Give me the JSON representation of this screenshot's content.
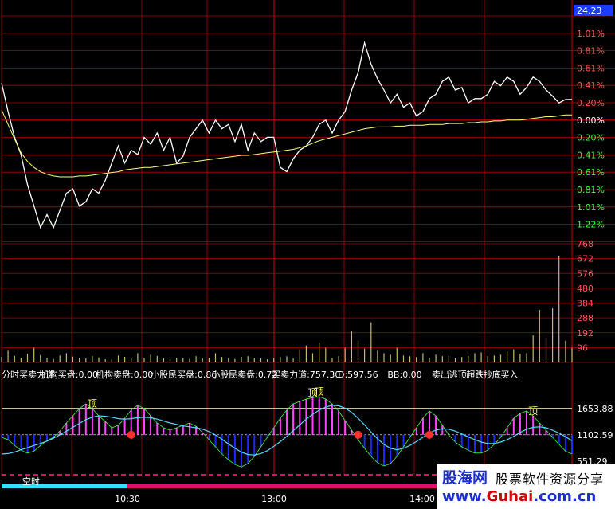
{
  "colors": {
    "price_line": "#ffffff",
    "avg_line": "#ffff80",
    "up_text": "#ff5555",
    "down_text": "#33ff33",
    "flat_text": "#ffffff",
    "grid": "#b00000",
    "volume_bar": "#c8b870",
    "indicator_pos": "#ff44ff",
    "indicator_neg": "#1a2bff",
    "indicator_light": "#44ff44",
    "signal_line": "#55d8ff",
    "threshold": "#ffffcc"
  },
  "price_panel": {
    "current_badge": "24.23",
    "right_labels": [
      {
        "text": "1.01%",
        "tone": "up"
      },
      {
        "text": "0.81%",
        "tone": "up"
      },
      {
        "text": "0.61%",
        "tone": "up"
      },
      {
        "text": "0.41%",
        "tone": "up"
      },
      {
        "text": "0.20%",
        "tone": "up"
      },
      {
        "text": "0.00%",
        "tone": "flat"
      },
      {
        "text": "0.20%",
        "tone": "down"
      },
      {
        "text": "0.41%",
        "tone": "down"
      },
      {
        "text": "0.61%",
        "tone": "down"
      },
      {
        "text": "0.81%",
        "tone": "down"
      },
      {
        "text": "1.01%",
        "tone": "down"
      },
      {
        "text": "1.22%",
        "tone": "down"
      }
    ]
  },
  "volume_panel": {
    "ticks": [
      "768",
      "672",
      "576",
      "480",
      "384",
      "288",
      "192",
      "96"
    ]
  },
  "indicator_panel": {
    "header": [
      {
        "text": "分时买卖力道",
        "color": "#ffffff"
      },
      {
        "text": "机构买盘:0.00",
        "color": "#ffffff"
      },
      {
        "text": "机构卖盘:0.00",
        "color": "#ffffff"
      },
      {
        "text": "小股民买盘:0.86",
        "color": "#ffffff"
      },
      {
        "text": "小股民卖盘:0.72",
        "color": "#ffffff"
      },
      {
        "text": "买卖力道:757.30",
        "color": "#ffffff"
      },
      {
        "text": "D:597.56",
        "color": "#ffffff"
      },
      {
        "text": "BB:0.00",
        "color": "#ffffff"
      },
      {
        "text": "卖出",
        "color": "#ffffff"
      },
      {
        "text": "逃顶",
        "color": "#ffffff"
      },
      {
        "text": "超跌",
        "color": "#ffffff"
      },
      {
        "text": "抄底",
        "color": "#ffffff"
      },
      {
        "text": "买入",
        "color": "#ffffff"
      }
    ],
    "ticks": [
      "1653.88",
      "1102.59",
      "551.29"
    ],
    "markers": [
      "顶",
      "顶",
      "顶",
      "顶"
    ],
    "bottom_label": "空时"
  },
  "time_axis": [
    "10:30",
    "13:00",
    "14:00"
  ],
  "watermark": {
    "brand": "股海网",
    "slogan": "股票软件资源分享",
    "url_prefix": "www.",
    "url_brand": "Guhai",
    "url_suffix": ".com.cn"
  },
  "chart_data": [
    {
      "type": "line",
      "title": "",
      "x_range": [
        "09:30",
        "15:00"
      ],
      "y_unit": "% change",
      "ylim": [
        -1.32,
        1.12
      ],
      "series": [
        {
          "values": [
            0.43,
            0.1,
            -0.2,
            -0.4,
            -0.75,
            -1.0,
            -1.25,
            -1.1,
            -1.25,
            -1.05,
            -0.85,
            -0.8,
            -1.0,
            -0.95,
            -0.8,
            -0.85,
            -0.7,
            -0.5,
            -0.3,
            -0.5,
            -0.35,
            -0.4,
            -0.2,
            -0.28,
            -0.15,
            -0.35,
            -0.2,
            -0.5,
            -0.42,
            -0.2,
            -0.1,
            0.0,
            -0.15,
            0.0,
            -0.1,
            -0.05,
            -0.25,
            -0.05,
            -0.35,
            -0.15,
            -0.25,
            -0.2,
            -0.2,
            -0.55,
            -0.6,
            -0.45,
            -0.35,
            -0.3,
            -0.2,
            -0.05,
            0.0,
            -0.15,
            0.0,
            0.1,
            0.35,
            0.55,
            0.9,
            0.65,
            0.48,
            0.35,
            0.2,
            0.3,
            0.15,
            0.2,
            0.05,
            0.1,
            0.25,
            0.3,
            0.45,
            0.5,
            0.35,
            0.38,
            0.2,
            0.25,
            0.25,
            0.3,
            0.45,
            0.4,
            0.5,
            0.45,
            0.3,
            0.38,
            0.5,
            0.45,
            0.35,
            0.28,
            0.2,
            0.24,
            0.24
          ]
        },
        {
          "values": [
            0.12,
            -0.05,
            -0.22,
            -0.38,
            -0.48,
            -0.55,
            -0.6,
            -0.63,
            -0.65,
            -0.66,
            -0.66,
            -0.66,
            -0.65,
            -0.65,
            -0.64,
            -0.63,
            -0.62,
            -0.61,
            -0.6,
            -0.58,
            -0.57,
            -0.56,
            -0.55,
            -0.55,
            -0.54,
            -0.53,
            -0.52,
            -0.51,
            -0.5,
            -0.49,
            -0.48,
            -0.47,
            -0.46,
            -0.45,
            -0.44,
            -0.43,
            -0.42,
            -0.41,
            -0.41,
            -0.4,
            -0.39,
            -0.38,
            -0.37,
            -0.36,
            -0.35,
            -0.34,
            -0.32,
            -0.3,
            -0.27,
            -0.24,
            -0.22,
            -0.2,
            -0.18,
            -0.16,
            -0.14,
            -0.12,
            -0.1,
            -0.09,
            -0.08,
            -0.08,
            -0.08,
            -0.07,
            -0.07,
            -0.06,
            -0.06,
            -0.06,
            -0.05,
            -0.05,
            -0.05,
            -0.04,
            -0.04,
            -0.04,
            -0.03,
            -0.03,
            -0.02,
            -0.02,
            -0.01,
            -0.01,
            0.0,
            0.0,
            0.0,
            0.01,
            0.02,
            0.03,
            0.04,
            0.04,
            0.05,
            0.06,
            0.06
          ]
        }
      ]
    },
    {
      "type": "bar",
      "title": "",
      "ylim": [
        0,
        768
      ],
      "values": [
        36,
        75,
        42,
        28,
        55,
        95,
        48,
        30,
        22,
        45,
        60,
        38,
        30,
        25,
        40,
        33,
        20,
        18,
        45,
        36,
        28,
        60,
        30,
        50,
        42,
        26,
        33,
        30,
        28,
        22,
        40,
        25,
        30,
        60,
        35,
        28,
        22,
        36,
        40,
        30,
        26,
        20,
        30,
        35,
        40,
        25,
        85,
        110,
        60,
        130,
        95,
        30,
        40,
        95,
        200,
        140,
        90,
        260,
        75,
        60,
        50,
        95,
        45,
        40,
        35,
        60,
        30,
        50,
        40,
        45,
        30,
        35,
        42,
        60,
        65,
        40,
        45,
        50,
        70,
        85,
        55,
        60,
        175,
        340,
        160,
        350,
        690,
        140,
        95
      ]
    },
    {
      "type": "bar",
      "title": "",
      "ylim": [
        0,
        2200
      ],
      "threshold": 1653.88,
      "series": [
        {
          "name": "买卖力道",
          "values": [
            1050,
            1000,
            880,
            780,
            720,
            760,
            880,
            980,
            1050,
            1180,
            1350,
            1500,
            1650,
            1750,
            1650,
            1500,
            1380,
            1250,
            1300,
            1450,
            1620,
            1720,
            1650,
            1500,
            1350,
            1250,
            1200,
            1250,
            1300,
            1350,
            1280,
            1150,
            1000,
            850,
            700,
            580,
            480,
            430,
            500,
            650,
            850,
            1050,
            1250,
            1450,
            1620,
            1750,
            1800,
            1850,
            1880,
            1900,
            1850,
            1750,
            1600,
            1400,
            1200,
            1000,
            820,
            650,
            520,
            450,
            500,
            650,
            850,
            1050,
            1250,
            1450,
            1600,
            1500,
            1300,
            1100,
            950,
            850,
            780,
            720,
            720,
            780,
            900,
            1050,
            1250,
            1450,
            1550,
            1600,
            1500,
            1350,
            1200,
            1050,
            900,
            760,
            700
          ]
        },
        {
          "name": "D",
          "values": [
            700,
            710,
            740,
            790,
            830,
            880,
            920,
            970,
            1030,
            1100,
            1180,
            1260,
            1340,
            1420,
            1470,
            1500,
            1490,
            1470,
            1440,
            1430,
            1440,
            1460,
            1470,
            1460,
            1430,
            1390,
            1350,
            1320,
            1290,
            1270,
            1250,
            1220,
            1170,
            1100,
            1010,
            910,
            820,
            740,
            690,
            680,
            710,
            770,
            860,
            960,
            1070,
            1190,
            1310,
            1430,
            1530,
            1620,
            1680,
            1720,
            1710,
            1660,
            1570,
            1450,
            1310,
            1160,
            1020,
            900,
            820,
            790,
            820,
            880,
            960,
            1050,
            1140,
            1200,
            1230,
            1220,
            1180,
            1120,
            1060,
            1000,
            950,
            920,
            920,
            950,
            1000,
            1070,
            1150,
            1220,
            1260,
            1270,
            1250,
            1200,
            1140,
            1060,
            980
          ]
        }
      ]
    }
  ]
}
